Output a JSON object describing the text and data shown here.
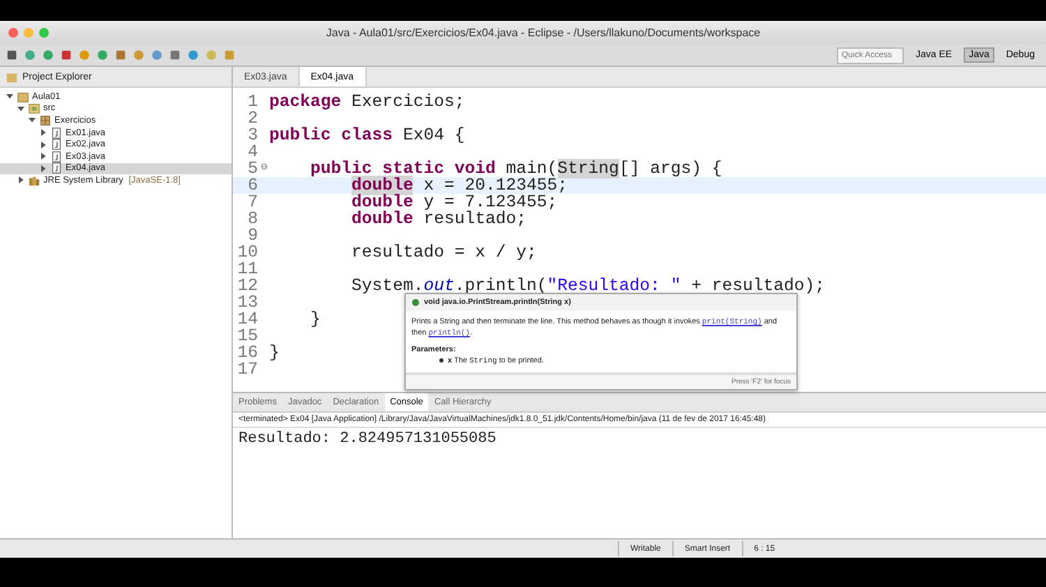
{
  "window": {
    "title": "Java - Aula01/src/Exercicios/Ex04.java - Eclipse - /Users/llakuno/Documents/workspace"
  },
  "toolbar": {
    "quick_access": {
      "placeholder": "Quick Access"
    },
    "perspectives": [
      {
        "label": "Java EE",
        "selected": false
      },
      {
        "label": "Java",
        "selected": true
      },
      {
        "label": "Debug",
        "selected": false
      }
    ]
  },
  "project_explorer": {
    "title": "Project Explorer",
    "tree": [
      {
        "label": "Aula01",
        "kind": "project",
        "expanded": true,
        "selected": false,
        "children": [
          {
            "label": "src",
            "kind": "folder",
            "expanded": true,
            "selected": false,
            "children": [
              {
                "label": "Exercicios",
                "kind": "package",
                "expanded": true,
                "selected": false,
                "children": [
                  {
                    "label": "Ex01.java",
                    "kind": "file",
                    "expanded": false,
                    "selected": false
                  },
                  {
                    "label": "Ex02.java",
                    "kind": "file",
                    "expanded": false,
                    "selected": false
                  },
                  {
                    "label": "Ex03.java",
                    "kind": "file",
                    "expanded": false,
                    "selected": false
                  },
                  {
                    "label": "Ex04.java",
                    "kind": "file",
                    "expanded": false,
                    "selected": true
                  }
                ]
              }
            ]
          },
          {
            "label": "JRE System Library",
            "decoration": "[JavaSE-1.8]",
            "kind": "library",
            "expanded": false,
            "selected": false
          }
        ]
      }
    ]
  },
  "editor": {
    "tabs": [
      {
        "label": "Ex03.java",
        "selected": false
      },
      {
        "label": "Ex04.java",
        "selected": true
      }
    ],
    "lines": [
      {
        "number": "1",
        "current": false,
        "tokens": [
          {
            "text": "package",
            "kind": "keyword"
          },
          {
            "text": " Exercicios;",
            "kind": "plain"
          }
        ]
      },
      {
        "number": "2",
        "current": false
      },
      {
        "number": "3",
        "current": false,
        "tokens": [
          {
            "text": "public class",
            "kind": "keyword"
          },
          {
            "text": " Ex04 {",
            "kind": "plain"
          }
        ]
      },
      {
        "number": "4",
        "current": false
      },
      {
        "number": "5",
        "fold": "⊖",
        "current": false,
        "tokens": [
          {
            "text": "    public static void",
            "kind": "keyword"
          },
          {
            "text": " main(",
            "kind": "plain"
          },
          {
            "text": "String",
            "kind": "occurrence"
          },
          {
            "text": "[] args) {",
            "kind": "plain"
          }
        ]
      },
      {
        "number": "6",
        "current": true,
        "tokens": [
          {
            "text": "        double",
            "kind": "selected_keyword"
          },
          {
            "text": " x = 20.123455;",
            "kind": "plain"
          }
        ]
      },
      {
        "number": "7",
        "current": false,
        "tokens": [
          {
            "text": "        double",
            "kind": "keyword"
          },
          {
            "text": " y = 7.123455;",
            "kind": "plain"
          }
        ]
      },
      {
        "number": "8",
        "current": false,
        "tokens": [
          {
            "text": "        double",
            "kind": "keyword"
          },
          {
            "text": " resultado;",
            "kind": "plain"
          }
        ]
      },
      {
        "number": "9",
        "current": false
      },
      {
        "number": "10",
        "current": false,
        "tokens": [
          {
            "text": "        resultado = x / y;",
            "kind": "plain"
          }
        ]
      },
      {
        "number": "11",
        "current": false
      },
      {
        "number": "12",
        "current": false,
        "tokens": [
          {
            "text": "        System.",
            "kind": "plain"
          },
          {
            "text": "out",
            "kind": "field"
          },
          {
            "text": ".println(",
            "kind": "plain"
          },
          {
            "text": "\"Resultado: \"",
            "kind": "string"
          },
          {
            "text": " + resultado);",
            "kind": "plain"
          }
        ]
      },
      {
        "number": "13",
        "current": false
      },
      {
        "number": "14",
        "current": false,
        "tokens": [
          {
            "text": "    }",
            "kind": "plain"
          }
        ]
      },
      {
        "number": "15",
        "current": false
      },
      {
        "number": "16",
        "current": false,
        "tokens": [
          {
            "text": "}",
            "kind": "plain"
          }
        ]
      },
      {
        "number": "17",
        "current": false
      }
    ],
    "hover": {
      "signature": "void java.io.PrintStream.println(String x)",
      "description": [
        {
          "text": "Prints a String and then terminate the line. This method behaves as though it invokes ",
          "kind": "text"
        },
        {
          "text": "print(String)",
          "kind": "link"
        },
        {
          "text": " and then ",
          "kind": "text"
        },
        {
          "text": "println()",
          "kind": "link"
        },
        {
          "text": ".",
          "kind": "text"
        }
      ],
      "parameters_label": "Parameters:",
      "parameter": {
        "name": "x",
        "text": " The ",
        "code": "String",
        "rest": " to be printed."
      },
      "footer": "Press 'F2' for focus"
    }
  },
  "bottom_panel": {
    "tabs": [
      {
        "label": "Problems",
        "selected": false
      },
      {
        "label": "Javadoc",
        "selected": false
      },
      {
        "label": "Declaration",
        "selected": false
      },
      {
        "label": "Console",
        "selected": true
      },
      {
        "label": "Call Hierarchy",
        "selected": false
      }
    ],
    "console_header": "<terminated> Ex04 [Java Application] /Library/Java/JavaVirtualMachines/jdk1.8.0_51.jdk/Contents/Home/bin/java (11 de fev de 2017 16:45:48)",
    "output": "Resultado: 2.824957131055085"
  },
  "status_bar": {
    "mode": "Writable",
    "insert": "Smart Insert",
    "position": "6 : 15"
  }
}
